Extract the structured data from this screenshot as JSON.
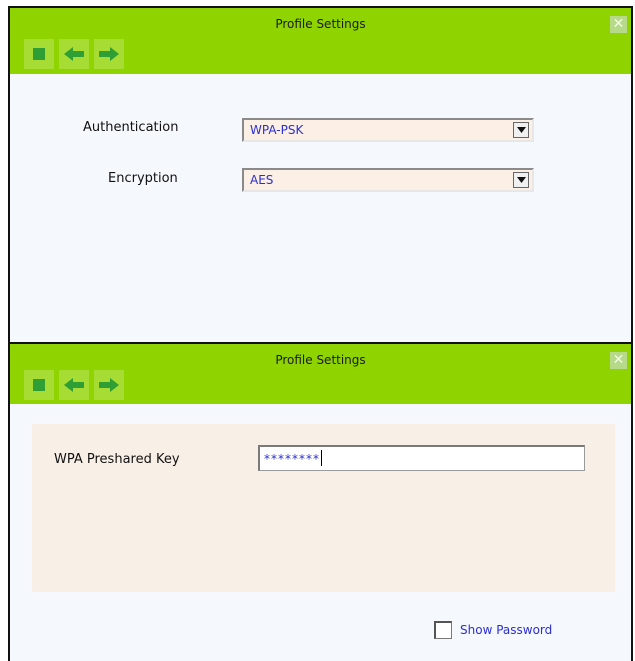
{
  "colors": {
    "title_bar": "#8fd400",
    "toolbar_button": "#a6dc33",
    "icon": "#2e9e35",
    "value_text": "#2b2fd0",
    "field_bg": "#fbefe6"
  },
  "window1": {
    "title": "Profile Settings",
    "toolbar": [
      "stop-icon",
      "back-arrow-icon",
      "forward-arrow-icon"
    ],
    "close_icon": "close-icon",
    "authentication": {
      "label": "Authentication",
      "value": "WPA-PSK"
    },
    "encryption": {
      "label": "Encryption",
      "value": "AES"
    }
  },
  "window2": {
    "title": "Profile Settings",
    "toolbar": [
      "stop-icon",
      "back-arrow-icon",
      "forward-arrow-icon"
    ],
    "close_icon": "close-icon",
    "psk": {
      "label": "WPA Preshared Key",
      "value": "********"
    },
    "show_password": {
      "label": "Show Password",
      "checked": false
    }
  }
}
